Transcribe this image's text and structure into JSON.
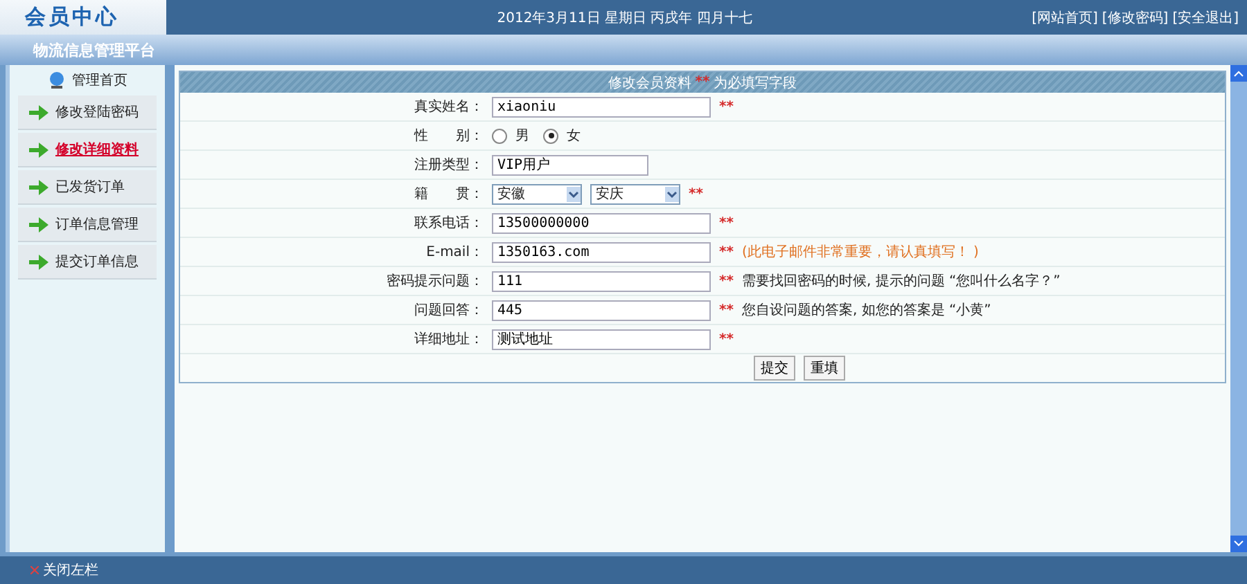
{
  "header": {
    "logo": "会员中心",
    "date": "2012年3月11日 星期日 丙戌年 四月十七",
    "links": [
      "[网站首页]",
      "[修改密码]",
      "[安全退出]"
    ],
    "subtitle": "物流信息管理平台"
  },
  "sidebar": {
    "home": "管理首页",
    "items": [
      {
        "label": "修改登陆密码",
        "selected": false
      },
      {
        "label": "修改详细资料",
        "selected": true
      },
      {
        "label": "已发货订单",
        "selected": false
      },
      {
        "label": "订单信息管理",
        "selected": false
      },
      {
        "label": "提交订单信息",
        "selected": false
      }
    ]
  },
  "form": {
    "title": "修改会员资料",
    "required_mark": "**",
    "title_suffix": "为必填写字段",
    "rows": [
      {
        "kind": "text",
        "label": "真实姓名：",
        "value": "xiaoniu",
        "mark": "**"
      },
      {
        "kind": "radio",
        "label": "性　　别：",
        "options": [
          {
            "label": "男",
            "selected": false
          },
          {
            "label": "女",
            "selected": true
          }
        ]
      },
      {
        "kind": "text",
        "label": "注册类型：",
        "value": "VIP用户",
        "short": true
      },
      {
        "kind": "select",
        "label": "籍　　贯：",
        "selects": [
          "安徽",
          "安庆"
        ],
        "mark": "**"
      },
      {
        "kind": "text",
        "label": "联系电话：",
        "value": "13500000000",
        "mark": "**"
      },
      {
        "kind": "text",
        "label": "E-mail：",
        "value": "1350163.com",
        "mark": "**",
        "warning": "(此电子邮件非常重要，请认真填写！ )"
      },
      {
        "kind": "text",
        "label": "密码提示问题：",
        "value": "111",
        "mark": "**",
        "note": "需要找回密码的时候, 提示的问题 “您叫什么名字？”"
      },
      {
        "kind": "text",
        "label": "问题回答：",
        "value": "445",
        "mark": "**",
        "note": "您自设问题的答案, 如您的答案是 “小黄”"
      },
      {
        "kind": "text",
        "label": "详细地址：",
        "value": "测试地址",
        "mark": "**"
      }
    ],
    "buttons": [
      "提交",
      "重填"
    ]
  },
  "footer": {
    "toggle": "关闭左栏"
  }
}
